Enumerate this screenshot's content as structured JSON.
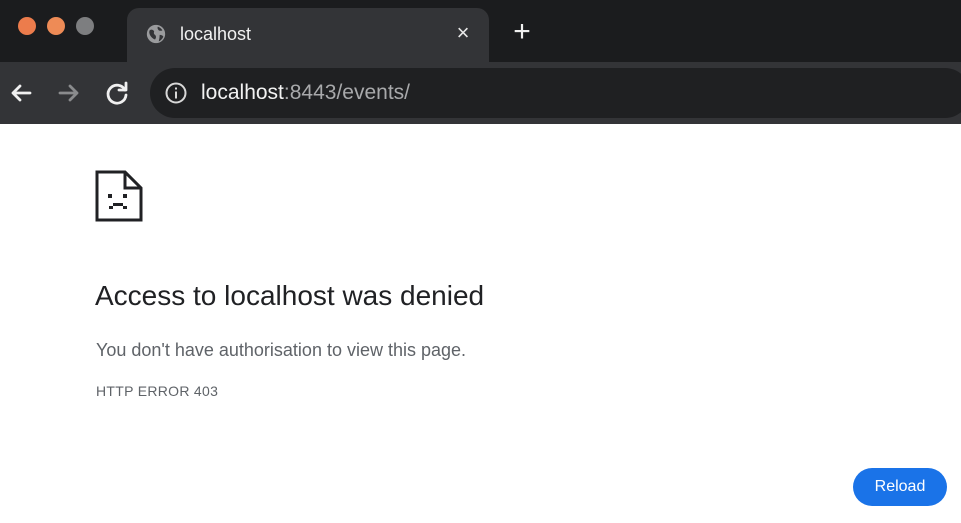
{
  "browser": {
    "tab": {
      "title": "localhost",
      "close_glyph": "×",
      "favicon": "globe-icon"
    },
    "new_tab_glyph": "+",
    "omnibox": {
      "url_host": "localhost",
      "url_rest": ":8443/events/",
      "icon": "info-icon"
    },
    "nav": {
      "back": "back-arrow-icon",
      "forward": "forward-arrow-icon",
      "reload": "reload-icon"
    }
  },
  "error_page": {
    "icon": "sad-page-icon",
    "title": "Access to localhost was denied",
    "message": "You don't have authorisation to view this page.",
    "code": "HTTP ERROR 403",
    "reload_label": "Reload"
  },
  "colors": {
    "tabstrip_bg": "#1b1c1e",
    "toolbar_bg": "#333437",
    "omnibox_bg": "#1f2022",
    "button_blue": "#1a73e8"
  }
}
